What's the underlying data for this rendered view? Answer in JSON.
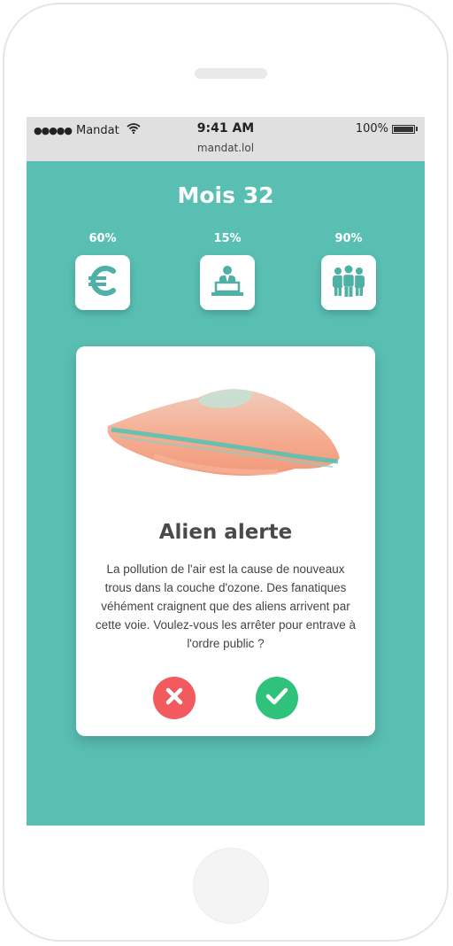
{
  "status_bar": {
    "signal_dots": "●●●●●",
    "carrier": "Mandat",
    "time": "9:41 AM",
    "url": "mandat.lol",
    "battery": "100%"
  },
  "header": {
    "title": "Mois 32"
  },
  "gauges": [
    {
      "label": "60%",
      "level": 0.6,
      "icon": "euro-icon"
    },
    {
      "label": "15%",
      "level": 0.15,
      "icon": "politician-podium-icon"
    },
    {
      "label": "90%",
      "level": 0.9,
      "icon": "people-group-icon"
    }
  ],
  "card": {
    "image": "ufo-image",
    "title": "Alien alerte",
    "text": "La pollution de l'air est la cause de nouveaux trous dans la couche d'ozone. Des fanatiques véhément craignent que des aliens arrivent par cette voie. Voulez-vous les arrêter pour entrave à l'ordre public ?",
    "reject_icon": "close-icon",
    "accept_icon": "check-icon"
  },
  "colors": {
    "background": "#59bfb3",
    "icon": "#4fb0a5",
    "reject": "#f25a5e",
    "accept": "#2fc27a",
    "ufo_body": "#f4a384",
    "ufo_band": "#4fc3b6"
  }
}
